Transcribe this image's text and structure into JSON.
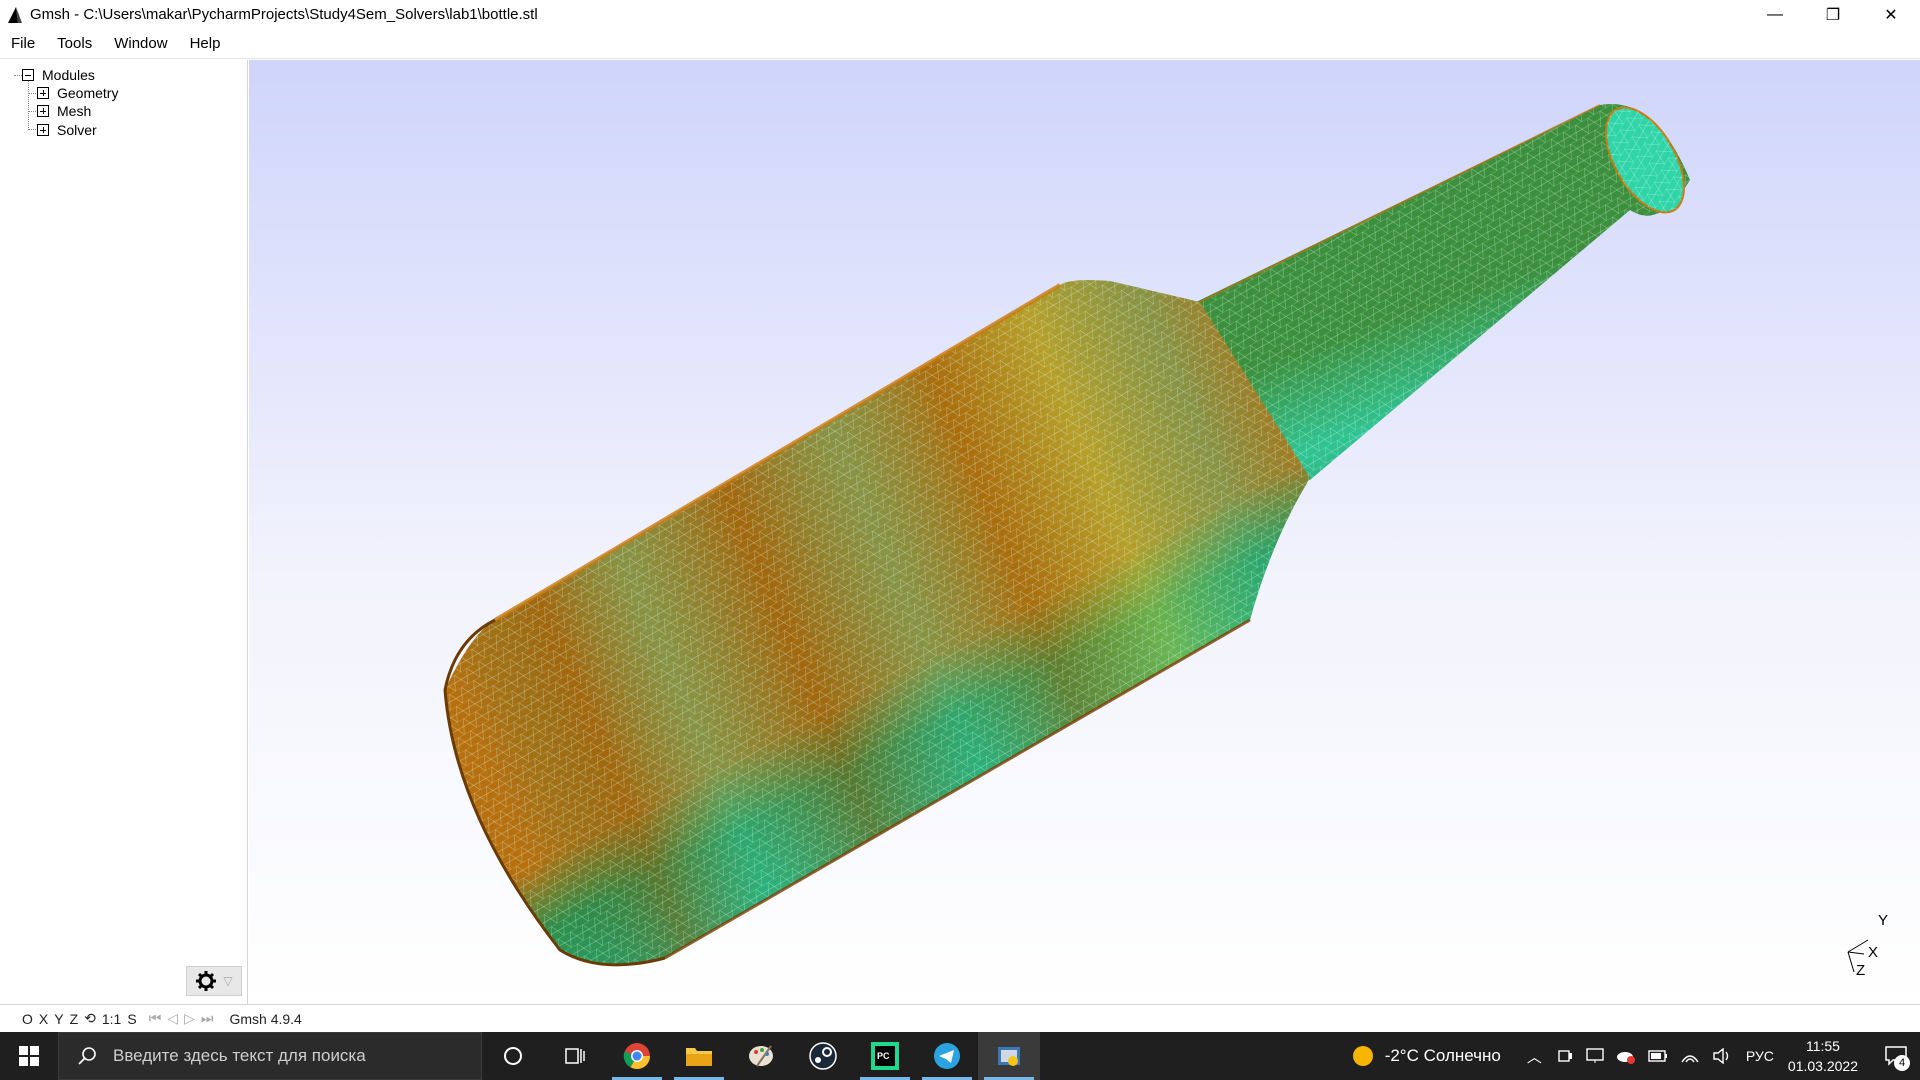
{
  "window": {
    "title": "Gmsh - C:\\Users\\makar\\PycharmProjects\\Study4Sem_Solvers\\lab1\\bottle.stl",
    "controls": [
      "—",
      "❐",
      "✕"
    ]
  },
  "menu": [
    "File",
    "Tools",
    "Window",
    "Help"
  ],
  "tree": {
    "root": "Modules",
    "children": [
      "Geometry",
      "Mesh",
      "Solver"
    ]
  },
  "axes": {
    "y": "Y",
    "x": "X",
    "z": "Z"
  },
  "status": {
    "buttons": [
      "O",
      "X",
      "Y",
      "Z",
      "⟲",
      "1:1",
      "S"
    ],
    "version": "Gmsh 4.9.4"
  },
  "taskbar": {
    "search_placeholder": "Введите здесь текст для поиска",
    "weather": "-2°C  Солнечно",
    "lang": "РУС",
    "time": "11:55",
    "date": "01.03.2022",
    "notifications": "4"
  },
  "colors": {
    "mesh_green": "#1f8f5a",
    "mesh_cyan": "#2fd4a8",
    "mesh_orange": "#c87a10",
    "viewport_top": "#cfd5fb",
    "taskbar_bg": "#1f1f1f"
  }
}
